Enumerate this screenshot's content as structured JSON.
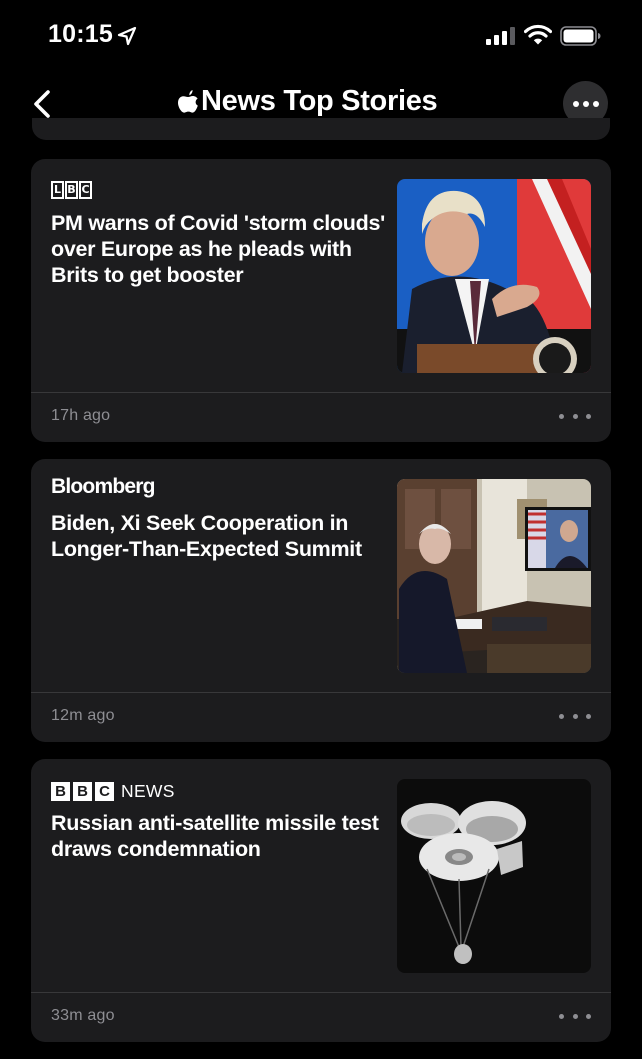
{
  "status_bar": {
    "time": "10:15"
  },
  "nav": {
    "title": "News Top Stories"
  },
  "cards": [
    {
      "publisher": "LBC",
      "publisher_letters": [
        "L",
        "B",
        "C"
      ],
      "headline": "PM warns of Covid 'storm clouds' over Europe as he pleads with Brits to get booster",
      "time_ago": "17h ago"
    },
    {
      "publisher": "Bloomberg",
      "headline": "Biden, Xi Seek Cooperation in Longer-Than-Expected Summit",
      "time_ago": "12m ago"
    },
    {
      "publisher_boxes": [
        "B",
        "B",
        "C"
      ],
      "publisher_suffix": "NEWS",
      "headline": "Russian anti-satellite missile test draws condemnation",
      "time_ago": "33m ago"
    }
  ],
  "colors": {
    "background": "#000000",
    "card": "#1c1c1e",
    "secondary_text": "#8e8e93",
    "divider": "#38383a"
  },
  "icons": [
    "location-arrow-icon",
    "cellular-signal-icon",
    "wifi-icon",
    "battery-icon",
    "chevron-left-icon",
    "apple-logo-icon",
    "ellipsis-icon"
  ]
}
